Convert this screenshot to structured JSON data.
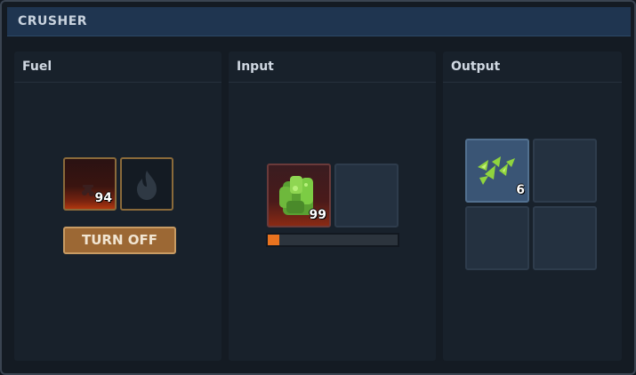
{
  "window": {
    "title": "CRUSHER"
  },
  "panels": {
    "fuel": {
      "title": "Fuel",
      "slots": [
        {
          "item_icon": "coal-fuel-icon",
          "count": "94"
        },
        {
          "item_icon": "flame-icon",
          "count": ""
        }
      ],
      "button_label": "TURN OFF"
    },
    "input": {
      "title": "Input",
      "slots": [
        {
          "item_icon": "green-ore-icon",
          "count": "99"
        },
        {
          "item_icon": "",
          "count": ""
        }
      ],
      "progress": 0.09
    },
    "output": {
      "title": "Output",
      "slots": [
        {
          "item_icon": "crushed-green-shards-icon",
          "count": "6"
        },
        {
          "item_icon": "",
          "count": ""
        },
        {
          "item_icon": "",
          "count": ""
        },
        {
          "item_icon": "",
          "count": ""
        }
      ]
    }
  },
  "colors": {
    "progress": "#e9731f",
    "button": "#9c6834",
    "titlebar": "#1f3550"
  }
}
